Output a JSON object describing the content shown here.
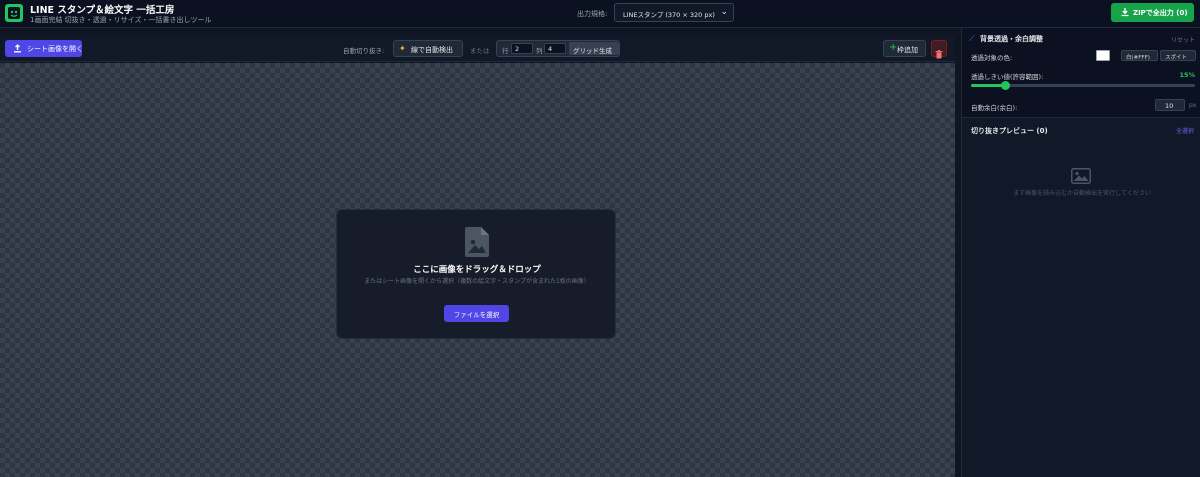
{
  "header": {
    "title": "LINE スタンプ＆絵文字 一括工房",
    "subtitle": "1画面完結 切抜き・透過・リサイズ・一括書き出しツール",
    "output_label": "出力規格:",
    "output_value": "LINEスタンプ (370 × 320 px)",
    "zip_button": "ZIPで全出力 (0)"
  },
  "toolbar": {
    "open_button": "シート画像を開く",
    "auto_label": "自動切り抜き:",
    "detect_button": "線で自動検出",
    "or_label": "または",
    "rows_label": "行",
    "rows_value": "2",
    "cols_label": "列",
    "cols_value": "4",
    "grid_button": "グリッド生成",
    "add_button": "枠追加"
  },
  "dropzone": {
    "title": "ここに画像をドラッグ＆ドロップ",
    "description": "またはシート画像を開くから選択（複数の絵文字・スタンプが含まれた1枚の画像）",
    "button": "ファイルを選択"
  },
  "settings": {
    "heading": "背景透過・余白調整",
    "reset": "リセット",
    "transparent_color_label": "透過対象の色:",
    "white_button": "白(#FFF)",
    "eyedropper_button": "スポイト",
    "tolerance_label": "透過しきい値(許容範囲):",
    "tolerance_value": "15%",
    "tolerance_fraction": 0.15,
    "margin_label": "自動余白(余白):",
    "margin_value": "10",
    "margin_unit": "px"
  },
  "preview": {
    "title": "切り抜きプレビュー (0)",
    "select_all": "全選択",
    "empty_text": "まず画像を読み込むか自動検出を実行してください"
  },
  "colors": {
    "accent": "#4f46e5",
    "green": "#16a34a",
    "background": "#0f1522"
  }
}
